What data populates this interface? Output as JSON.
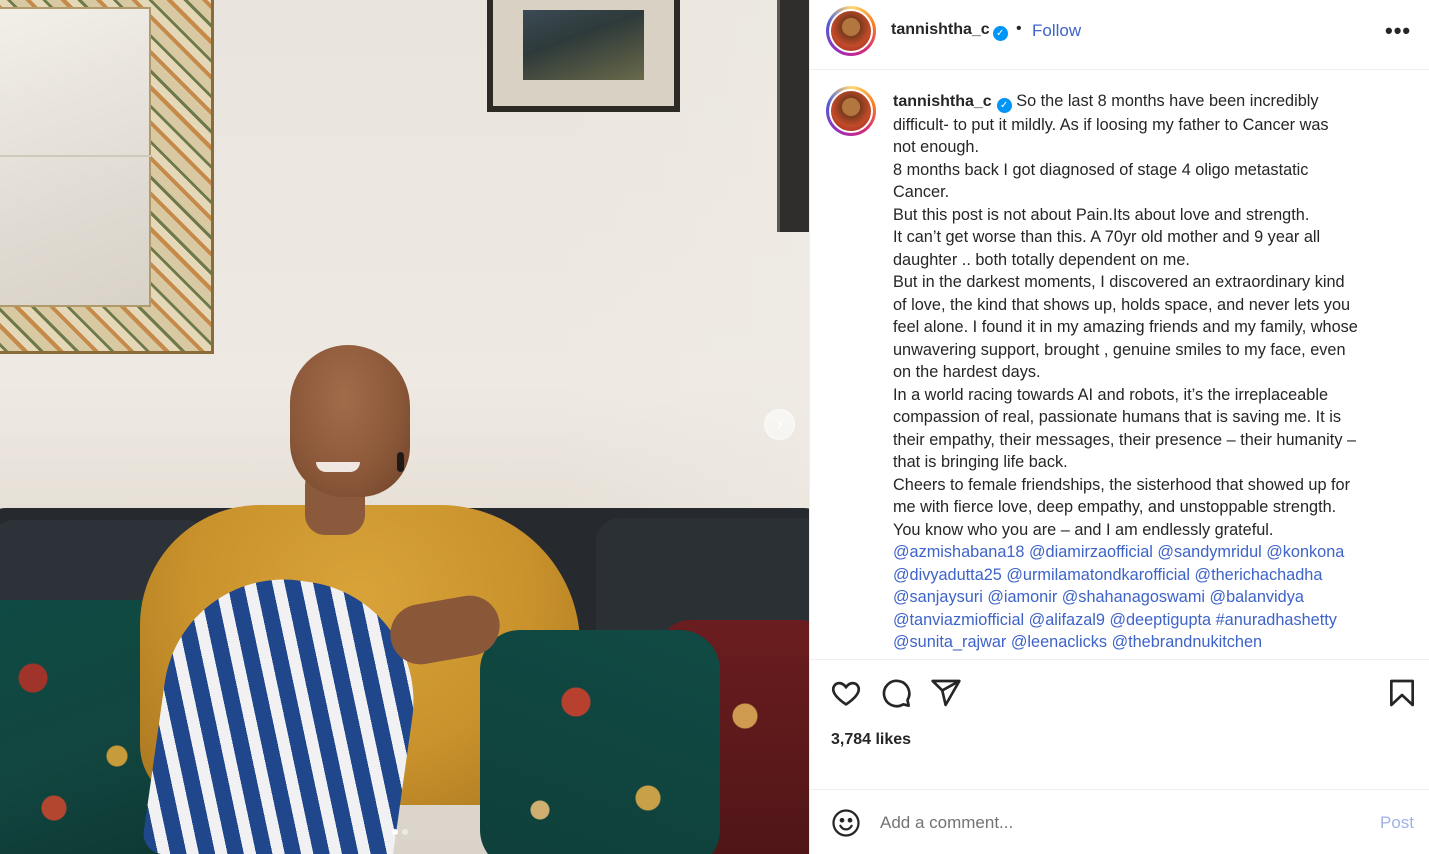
{
  "post": {
    "username": "tannishtha_c",
    "follow_label": "Follow",
    "separator": "•",
    "more_label": "•••",
    "verified_mark": "✓",
    "carousel": {
      "next_label": "›",
      "slide_count": 2,
      "active_slide": 1
    },
    "caption_lines": [
      "So the last 8 months have been incredibly",
      "difficult- to put it mildly. As if loosing my father to Cancer was",
      "not enough.",
      "8 months back I got diagnosed of stage 4 oligo metastatic",
      "Cancer.",
      "But this post is not about Pain.Its about love and strength.",
      "It can’t get worse than this. A 70yr old mother and 9 year all",
      "daughter .. both totally dependent on me.",
      "But in the darkest moments, I discovered an extraordinary kind",
      "of love, the kind that shows up, holds space, and never lets you",
      "feel alone. I found it in my amazing friends and my family, whose",
      "unwavering support, brought , genuine smiles to my face, even",
      "on the hardest days.",
      "In a world racing towards AI and robots, it’s the irreplaceable",
      "compassion of real, passionate humans that is saving me. It is",
      "their empathy, their messages, their presence – their humanity –",
      "that is bringing life back.",
      "Cheers to female friendships, the sisterhood that showed up for",
      "me with fierce love, deep empathy, and unstoppable strength.",
      "You know who you are – and I am endlessly grateful."
    ],
    "mention_lines": [
      "@azmishabana18 @diamirzaofficial @sandymridul @konkona",
      "@divyadutta25 @urmilamatondkarofficial @therichachadha",
      "@sanjaysuri @iamonir @shahanagoswami @balanvidya",
      "@tanviazmiofficial @alifazal9 @deeptigupta #anuradhashetty",
      "@sunita_rajwar @leenaclicks @thebrandnukitchen"
    ],
    "likes": "3,784 likes",
    "comment": {
      "placeholder": "Add a comment...",
      "post_label": "Post"
    },
    "icons": [
      "heart-icon",
      "comment-icon",
      "share-icon",
      "bookmark-icon",
      "emoji-icon",
      "verified-icon"
    ],
    "colors": {
      "link": "#3e63c9",
      "verified": "#0095f6",
      "post_disabled": "#9fb3e6",
      "text": "#262626"
    }
  }
}
